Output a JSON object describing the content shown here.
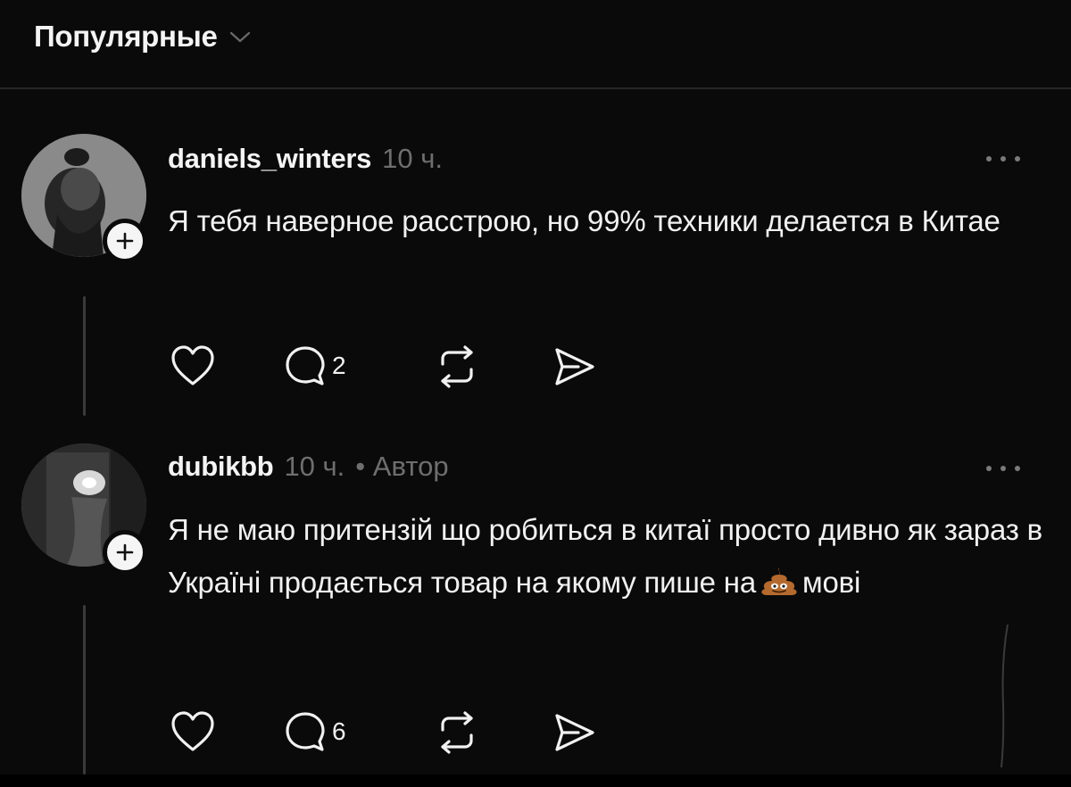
{
  "header": {
    "sort_label": "Популярные",
    "chevron_icon": "chevron-down-icon"
  },
  "comments": [
    {
      "username": "daniels_winters",
      "time": "10 ч.",
      "author_tag": "",
      "text": "Я тебя наверное расстрою, но 99% техники делается в Китае",
      "like_count": "",
      "reply_count": "2",
      "icons": [
        "heart-icon",
        "comment-icon",
        "repost-icon",
        "share-icon",
        "more-icon"
      ]
    },
    {
      "username": "dubikbb",
      "time": "10 ч.",
      "author_tag": "• Автор",
      "text_before_emoji": "Я не маю притензій що робиться в китаї просто дивно як зараз в Україні продається товар на якому пише на",
      "emoji": "poo-emoji",
      "text_after_emoji": "мові",
      "like_count": "",
      "reply_count": "6",
      "icons": [
        "heart-icon",
        "comment-icon",
        "repost-icon",
        "share-icon",
        "more-icon"
      ]
    }
  ],
  "colors": {
    "background": "#0a0a0a",
    "text_primary": "#f1f1f1",
    "text_secondary": "#6e6e6e",
    "divider": "#262626"
  }
}
